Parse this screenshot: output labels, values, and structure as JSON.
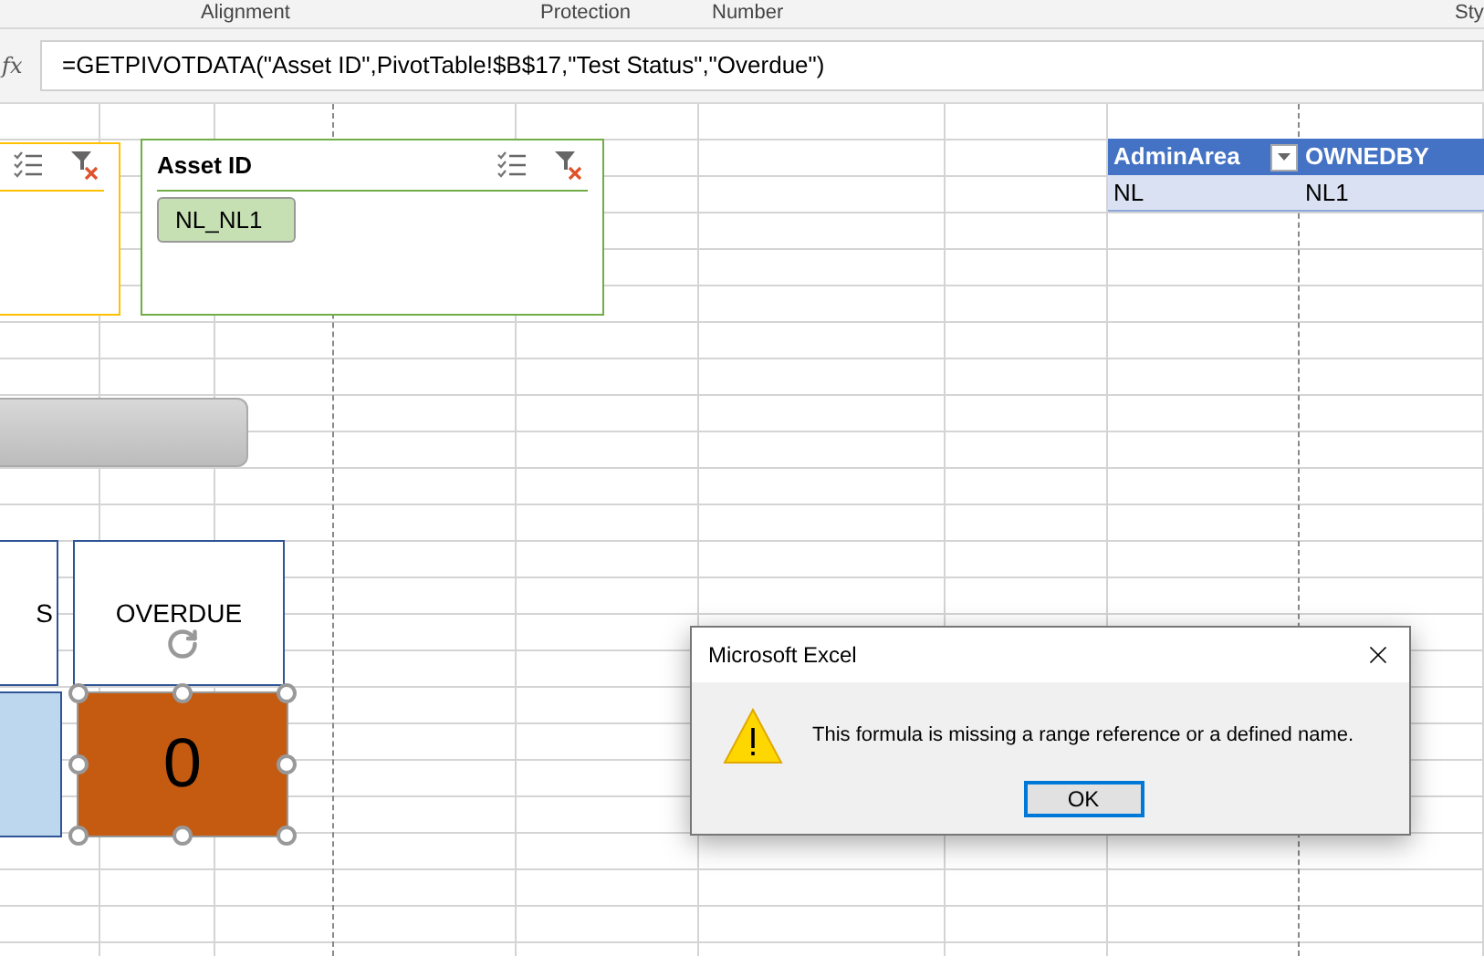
{
  "ribbon_groups": [
    "Alignment",
    "Protection",
    "Number",
    "Sty"
  ],
  "formula_bar": {
    "function_label": "fx",
    "formula": "=GETPIVOTDATA(\"Asset ID\",PivotTable!$B$17,\"Test Status\",\"Overdue\")"
  },
  "slicer": {
    "title": "Asset ID",
    "items": [
      {
        "label": "NL_NL1",
        "selected": true
      }
    ]
  },
  "table": {
    "columns": [
      "AdminArea",
      "OWNEDBY"
    ],
    "rows": [
      [
        "NL",
        "NL1"
      ]
    ]
  },
  "cards": [
    {
      "label": "S",
      "color": "#bdd7ee",
      "selected": false
    },
    {
      "label": "OVERDUE",
      "value": "0",
      "color": "#c55a11",
      "selected": true
    }
  ],
  "dialog": {
    "title": "Microsoft Excel",
    "message": "This formula is missing a range reference or a defined name.",
    "buttons": [
      {
        "label": "OK",
        "focused": true
      }
    ]
  }
}
